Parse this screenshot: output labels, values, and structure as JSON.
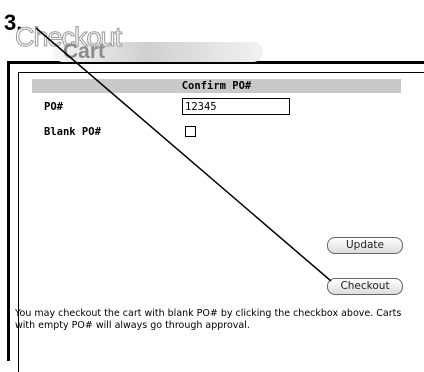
{
  "annotation": {
    "step_number": "3."
  },
  "logo": {
    "word1": "Checkout",
    "word2": "Cart"
  },
  "confirm": {
    "header": "Confirm PO#",
    "po_label": "PO#",
    "po_value": "12345",
    "blank_label": "Blank PO#",
    "blank_checked": false
  },
  "buttons": {
    "update_label": "Update",
    "checkout_label": "Checkout"
  },
  "note": "You may checkout the cart with blank PO# by clicking the checkbox above. Carts with empty PO# will always go through approval."
}
